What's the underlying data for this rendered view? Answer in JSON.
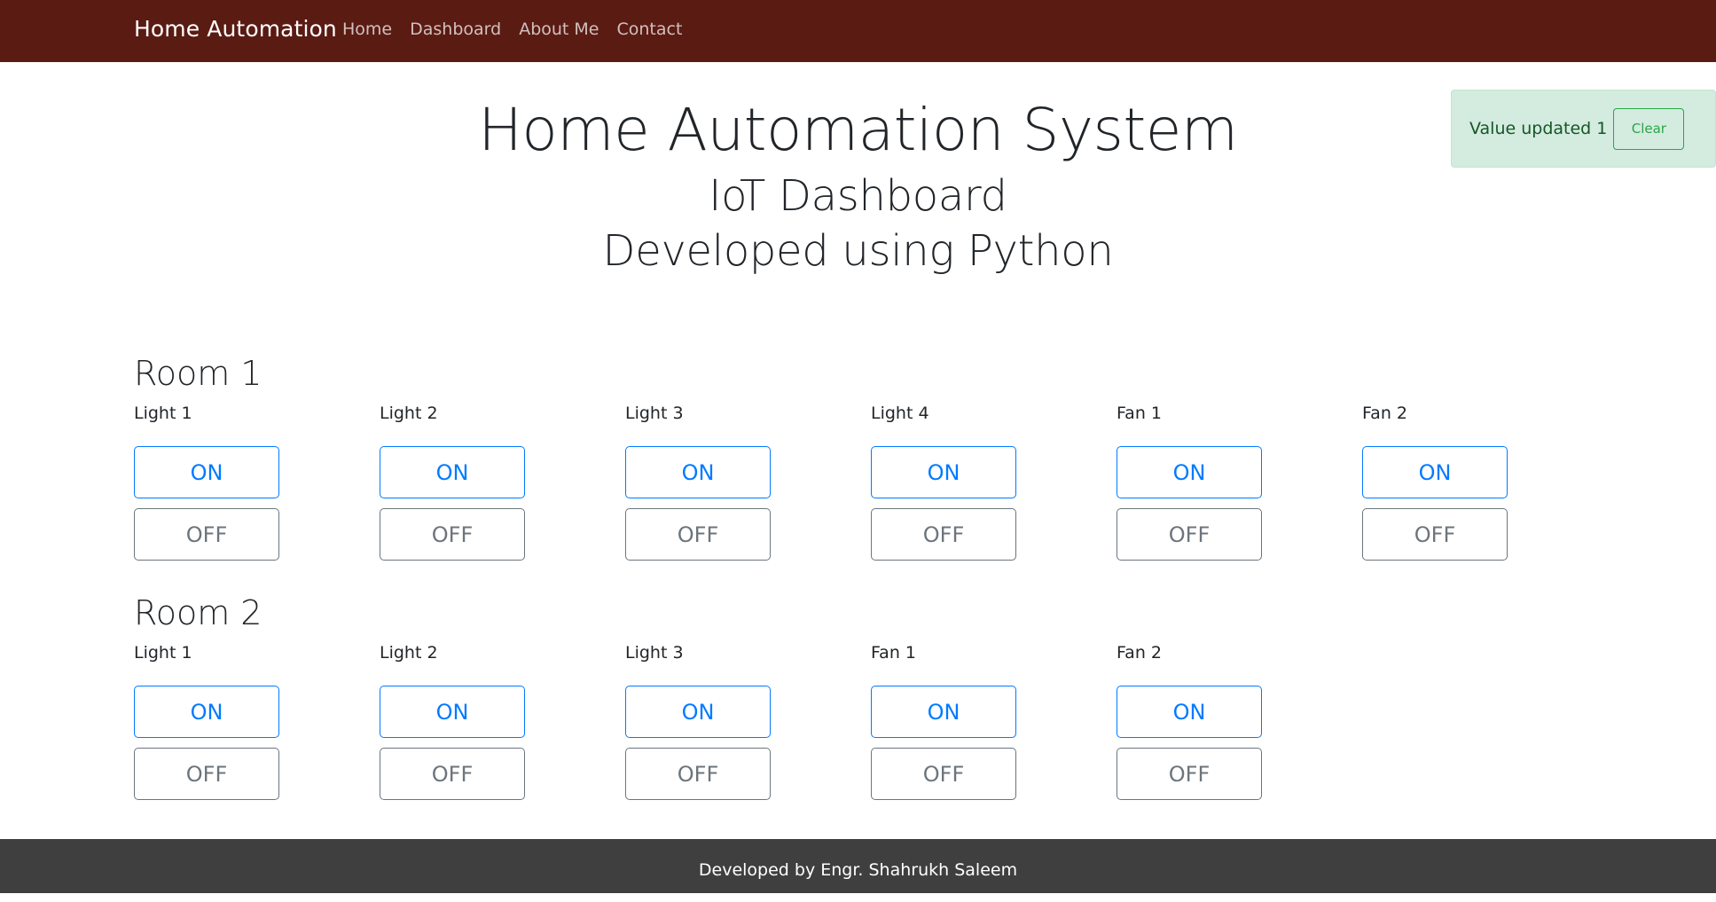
{
  "navbar": {
    "brand": "Home Automation",
    "links": [
      "Home",
      "Dashboard",
      "About Me",
      "Contact"
    ],
    "background": "#5a1b13"
  },
  "hero": {
    "title": "Home Automation System",
    "subtitle1": "IoT Dashboard",
    "subtitle2": "Developed using Python"
  },
  "alert": {
    "text": "Value updated 1",
    "button_label": "Clear",
    "color": "#d4ebe0"
  },
  "rooms": [
    {
      "title": "Room 1",
      "devices": [
        {
          "label": "Light 1",
          "on": "ON",
          "off": "OFF"
        },
        {
          "label": "Light 2",
          "on": "ON",
          "off": "OFF"
        },
        {
          "label": "Light 3",
          "on": "ON",
          "off": "OFF"
        },
        {
          "label": "Light 4",
          "on": "ON",
          "off": "OFF"
        },
        {
          "label": "Fan 1",
          "on": "ON",
          "off": "OFF"
        },
        {
          "label": "Fan 2",
          "on": "ON",
          "off": "OFF"
        }
      ]
    },
    {
      "title": "Room 2",
      "devices": [
        {
          "label": "Light 1",
          "on": "ON",
          "off": "OFF"
        },
        {
          "label": "Light 2",
          "on": "ON",
          "off": "OFF"
        },
        {
          "label": "Light 3",
          "on": "ON",
          "off": "OFF"
        },
        {
          "label": "Fan 1",
          "on": "ON",
          "off": "OFF"
        },
        {
          "label": "Fan 2",
          "on": "ON",
          "off": "OFF"
        }
      ]
    }
  ],
  "footer": {
    "text": "Developed by Engr. Shahrukh Saleem",
    "background": "#3f3f3f"
  }
}
